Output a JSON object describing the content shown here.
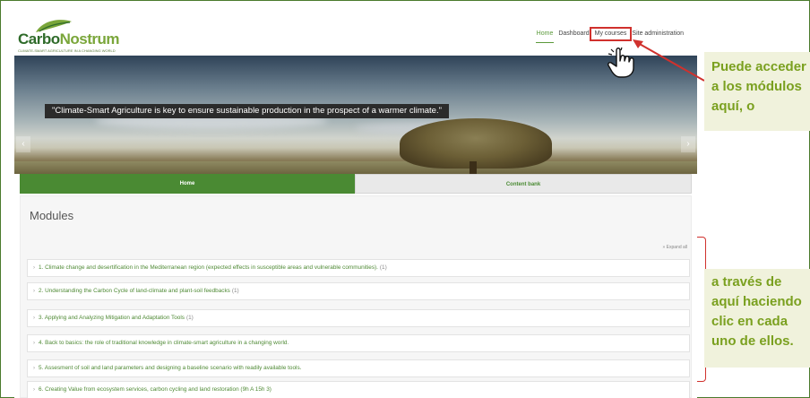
{
  "site": {
    "logo": {
      "name_part1": "Carbo",
      "name_part2": "Nostrum",
      "tagline": "CLIMATE-SMART AGRICULTURE IN A CHANGING WORLD"
    },
    "nav": [
      {
        "label": "Home",
        "active": true
      },
      {
        "label": "Dashboard"
      },
      {
        "label": "My courses",
        "highlighted": true
      },
      {
        "label": "Site administration"
      }
    ],
    "hero": {
      "quote": "\"Climate-Smart Agriculture is key to ensure sustainable production in the prospect of a warmer climate.\"",
      "prev": "‹",
      "next": "›"
    },
    "tabs": [
      {
        "label": "Home",
        "active": true
      },
      {
        "label": "Content bank"
      }
    ],
    "modules": {
      "heading": "Modules",
      "expand_all": "» Expand all",
      "items": [
        {
          "title": "1. Climate change and desertification in the Mediterranean region (expected effects in susceptible areas and vulnerable communities).",
          "count": "(1)"
        },
        {
          "title": "2. Understanding the Carbon Cycle of land-climate and plant-soil feedbacks",
          "count": "(1)"
        },
        {
          "title": "3. Applying and Analyzing Mitigation and Adaptation Tools",
          "count": "(1)"
        },
        {
          "title": "4. Back to basics: the role of traditional knowledge in climate-smart agriculture in a changing world.",
          "count": ""
        },
        {
          "title": "5. Assesment of soil and land parameters and designing a baseline scenario with readily available tools.",
          "count": ""
        },
        {
          "title": "6. Creating Value from ecosystem services, carbon cycling and land restoration (9h A 15h 3)",
          "count": ""
        }
      ]
    }
  },
  "annotations": {
    "callout_top": [
      "Puede acceder",
      "a los módulos",
      "aquí, o"
    ],
    "callout_bottom": [
      "a través de",
      "aquí haciendo",
      "clic en cada",
      "uno de ellos."
    ],
    "colors": {
      "annotation_red": "#d0312d",
      "callout_green": "#7aa01f",
      "brand_green": "#4a8a33"
    }
  }
}
